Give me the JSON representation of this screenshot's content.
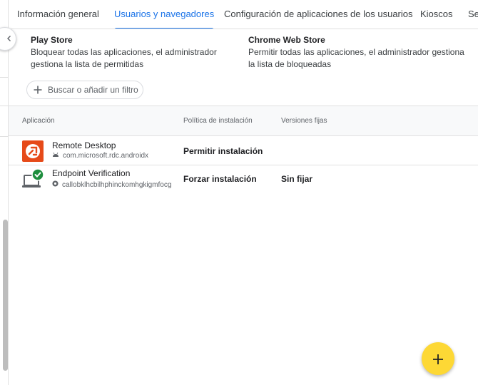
{
  "tabs": [
    {
      "label": "Información general"
    },
    {
      "label": "Usuarios y navegadores"
    },
    {
      "label": "Configuración de aplicaciones de los usuarios"
    },
    {
      "label": "Kioscos"
    },
    {
      "label": "Se"
    }
  ],
  "active_tab": "Usuarios y navegadores",
  "stores": {
    "play": {
      "title": "Play Store",
      "desc_line1": "Bloquear todas las aplicaciones, el administrador",
      "desc_line2": "gestiona la lista de permitidas"
    },
    "chrome": {
      "title": "Chrome Web Store",
      "desc_line1": "Permitir todas las aplicaciones, el administrador gestiona",
      "desc_line2": "la lista de bloqueadas"
    }
  },
  "filter": {
    "label": "Buscar o añadir un filtro"
  },
  "table": {
    "columns": [
      "Aplicación",
      "Política de instalación",
      "Versiones fijas"
    ],
    "rows": [
      {
        "name": "Remote Desktop",
        "id": "com.microsoft.rdc.androidx",
        "platform_icon": "android-icon",
        "policy": "Permitir instalación",
        "version": ""
      },
      {
        "name": "Endpoint Verification",
        "id": "callobklhcbilhphinckomhgkigmfocg",
        "platform_icon": "chrome-icon",
        "policy": "Forzar instalación",
        "version": "Sin fijar"
      }
    ]
  },
  "colors": {
    "accent": "#1a73e8",
    "fab": "#fdd835",
    "remote_desktop": "#e64a19",
    "endpoint_check": "#1e8e3e"
  },
  "icons": {
    "collapse": "chevron-left-icon",
    "filter": "plus-icon",
    "fab": "plus-icon"
  }
}
